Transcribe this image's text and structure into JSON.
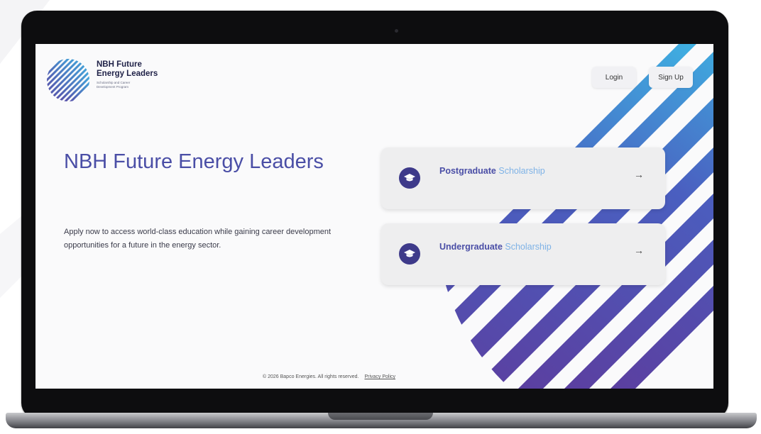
{
  "brand": {
    "name": "NBH Future\nEnergy Leaders",
    "subtitle": "Scholarship and Career\nDevelopment Program"
  },
  "nav": {
    "login_label": "Login",
    "signup_label": "Sign Up"
  },
  "hero": {
    "title": "NBH Future Energy Leaders",
    "description": "Apply now to access world-class education while gaining career development opportunities for a future in the energy sector."
  },
  "cards": [
    {
      "label_primary": "Postgraduate",
      "label_secondary": "Scholarship",
      "icon": "graduation-cap-icon",
      "arrow": "→"
    },
    {
      "label_primary": "Undergraduate",
      "label_secondary": "Scholarship",
      "icon": "graduation-cap-icon",
      "arrow": "→"
    }
  ],
  "footer": {
    "copyright": "© 2026 Bapco Energies. All rights reserved.",
    "privacy_label": "Privacy Policy"
  },
  "colors": {
    "brand_indigo": "#4a4ea6",
    "accent_light_blue": "#7eb2e6",
    "stripe_start": "#5b3fa0",
    "stripe_end": "#3eb6e4",
    "laptop_bezel": "#0d0d0f"
  }
}
